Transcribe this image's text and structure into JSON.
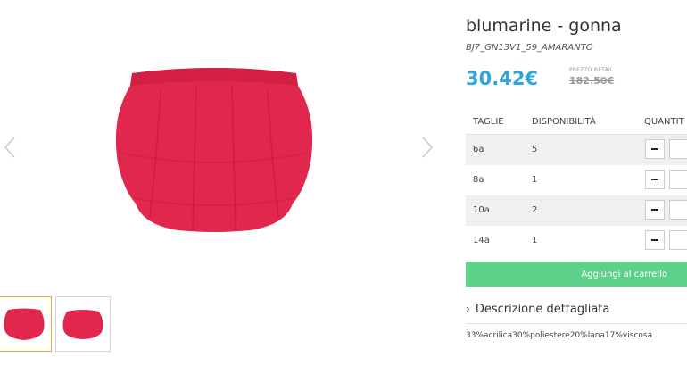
{
  "product": {
    "title": "blumarine - gonna",
    "sku": "BJ7_GN13V1_59_AMARANTO",
    "price": "30.42€",
    "retail_label": "PREZZO RETAIL",
    "retail_price": "182.50€"
  },
  "gallery": {
    "main_image": "red-skirt-image",
    "thumbnails": [
      "red-skirt-front",
      "red-skirt-back"
    ],
    "active_thumbnail": 0
  },
  "sizes_table": {
    "headers": [
      "TAGLIE",
      "DISPONIBILITÀ",
      "QUANTIT"
    ],
    "rows": [
      {
        "size": "6a",
        "availability": "5"
      },
      {
        "size": "8a",
        "availability": "1"
      },
      {
        "size": "10a",
        "availability": "2"
      },
      {
        "size": "14a",
        "availability": "1"
      }
    ]
  },
  "actions": {
    "add_to_cart": "Aggiungi al carrello"
  },
  "description": {
    "toggle_label": "Descrizione dettagliata",
    "composition": "33%acrilica30%poliestere20%lana17%viscosa"
  },
  "colors": {
    "accent_price": "#31a5d8",
    "cart_button": "#5fd08a",
    "skirt": "#e2274e"
  }
}
